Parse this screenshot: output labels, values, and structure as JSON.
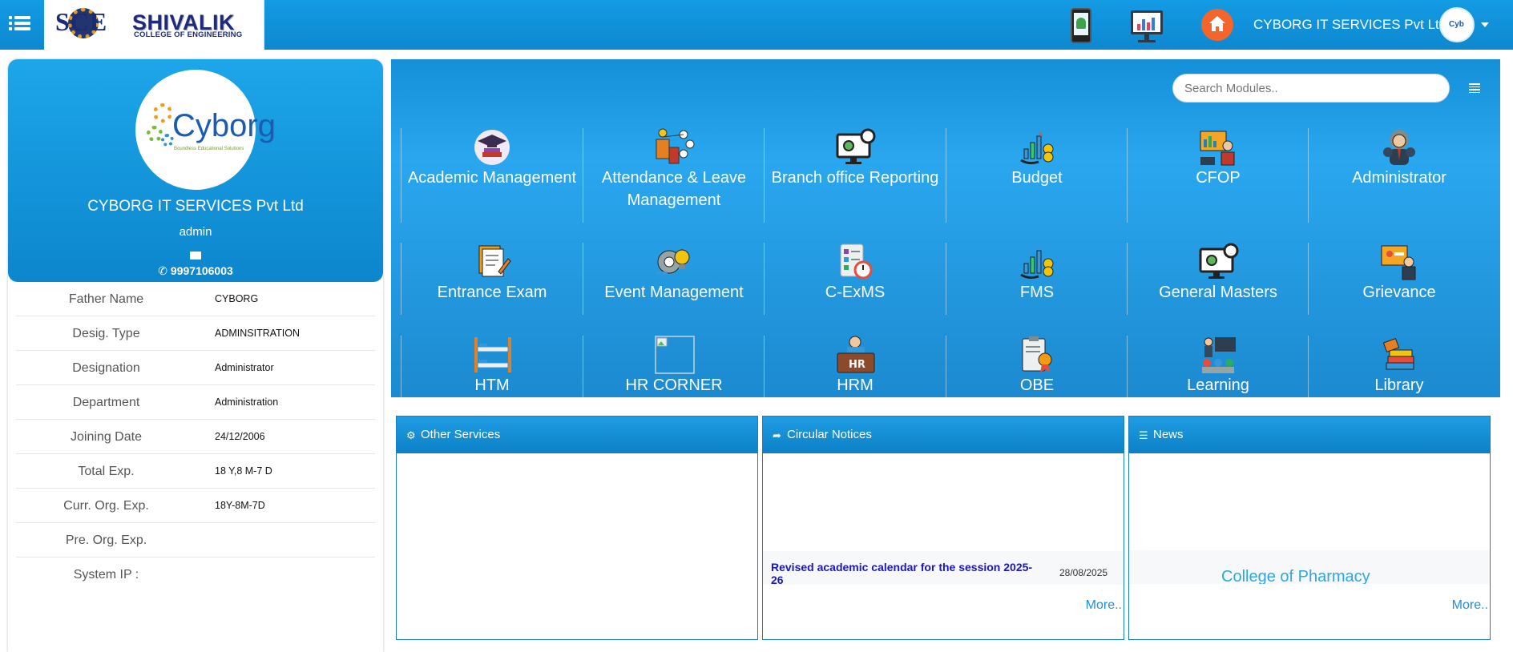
{
  "header": {
    "logo_text": "SHIVALIK",
    "logo_subtitle": "COLLEGE OF ENGINEERING",
    "logo_monogram": "SCE",
    "company": "CYBORG IT SERVICES Pvt Ltd"
  },
  "profile": {
    "company": "CYBORG IT SERVICES Pvt Ltd",
    "username": "admin",
    "phone": "9997106003",
    "logo_text": "Cyborg",
    "rows": [
      {
        "label": "Father Name",
        "value": "CYBORG"
      },
      {
        "label": "Desig. Type",
        "value": "ADMINSITRATION"
      },
      {
        "label": "Designation",
        "value": "Administrator"
      },
      {
        "label": "Department",
        "value": "Administration"
      },
      {
        "label": "Joining Date",
        "value": "24/12/2006"
      },
      {
        "label": "Total Exp.",
        "value": "18 Y,8 M-7 D"
      },
      {
        "label": "Curr. Org. Exp.",
        "value": "18Y-8M-7D"
      },
      {
        "label": "Pre. Org. Exp.",
        "value": ""
      },
      {
        "label": "System IP :",
        "value": ""
      }
    ]
  },
  "search": {
    "placeholder": "Search Modules.."
  },
  "modules": [
    {
      "label": "Academic Management",
      "icon": "graduation-cap-icon"
    },
    {
      "label": "Attendance & Leave Management",
      "icon": "attendance-icon"
    },
    {
      "label": "Branch office Reporting",
      "icon": "monitor-gear-icon"
    },
    {
      "label": "Budget",
      "icon": "budget-chart-icon"
    },
    {
      "label": "CFOP",
      "icon": "presentation-icon"
    },
    {
      "label": "Administrator",
      "icon": "admin-user-icon"
    },
    {
      "label": "Entrance Exam",
      "icon": "exam-paper-icon"
    },
    {
      "label": "Event Management",
      "icon": "event-gear-icon"
    },
    {
      "label": "C-ExMS",
      "icon": "checklist-clock-icon"
    },
    {
      "label": "FMS",
      "icon": "fms-chart-icon"
    },
    {
      "label": "General Masters",
      "icon": "monitor-gear-icon"
    },
    {
      "label": "Grievance",
      "icon": "grievance-icon"
    },
    {
      "label": "HTM",
      "icon": "bunk-bed-icon"
    },
    {
      "label": "HR CORNER",
      "icon": "broken-image-icon"
    },
    {
      "label": "HRM",
      "icon": "hr-desk-icon"
    },
    {
      "label": "OBE",
      "icon": "clipboard-badge-icon"
    },
    {
      "label": "Learning",
      "icon": "classroom-icon"
    },
    {
      "label": "Library",
      "icon": "books-icon"
    }
  ],
  "boxes": {
    "other_services": {
      "title": "Other Services"
    },
    "circular_notices": {
      "title": "Circular Notices",
      "notice_text": "Revised academic calendar for the session 2025-26",
      "notice_date": "28/08/2025",
      "more": "More.."
    },
    "news": {
      "title": "News",
      "item_text": "College of Pharmacy",
      "more": "More.."
    }
  },
  "colors": {
    "primary_blue": "#129be4",
    "notice_link": "#1a16c7",
    "home_orange": "#f3652b"
  }
}
